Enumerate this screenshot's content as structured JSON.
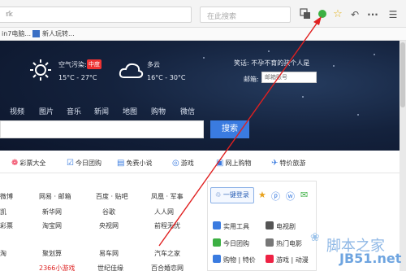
{
  "toolbar": {
    "address_text": "rk",
    "search_placeholder": "在此搜索",
    "icons": [
      "translate-icon",
      "green-dot-icon",
      "star-icon",
      "undo-icon",
      "more-icon",
      "menu-icon"
    ]
  },
  "bookmarks": [
    {
      "label": "in7电脑..."
    },
    {
      "label": "新人玩转..."
    }
  ],
  "weather": {
    "air_label": "空气污染:",
    "air_badge": "中度",
    "today_temp": "15°C - 27°C",
    "tomorrow_label": "多云",
    "tomorrow_temp": "16°C - 30°C"
  },
  "notice": "笑话: 不孕不育的孩个人是",
  "mail": {
    "label": "邮箱:",
    "placeholder": "邮箱账号"
  },
  "nav_tabs": [
    "视频",
    "图片",
    "音乐",
    "新闻",
    "地图",
    "购物",
    "微信"
  ],
  "search": {
    "button": "搜索"
  },
  "quick_links": [
    {
      "icon": "lottery-icon",
      "label": "彩票大全"
    },
    {
      "icon": "group-buy-icon",
      "label": "今日团购"
    },
    {
      "icon": "novel-icon",
      "label": "免费小说"
    },
    {
      "icon": "game-icon",
      "label": "游戏"
    },
    {
      "icon": "shop-icon",
      "label": "网上购物"
    },
    {
      "icon": "travel-icon",
      "label": "特价旅游"
    }
  ],
  "link_grid": [
    [
      "微博",
      "网易 · 邮箱",
      "百度 · 贴吧",
      "凤凰 · 军事"
    ],
    [
      "凯",
      "新华网",
      "谷歌",
      "人人网"
    ],
    [
      "彩票",
      "淘宝网",
      "央视网",
      "前程无忧"
    ],
    [
      "淘",
      "聚划算",
      "易车网",
      "汽车之家"
    ],
    [
      "",
      "2366小游戏",
      "世纪佳缘",
      "百合婚恋网"
    ]
  ],
  "panel": {
    "login": "一键登录",
    "items": [
      [
        "实用工具",
        "电视剧"
      ],
      [
        "今日团购",
        "热门电影"
      ],
      [
        "购物 | 特价",
        "游戏 | 动漫"
      ]
    ]
  },
  "watermark": {
    "line1": "脚本之家",
    "line2": "JB51.net"
  }
}
